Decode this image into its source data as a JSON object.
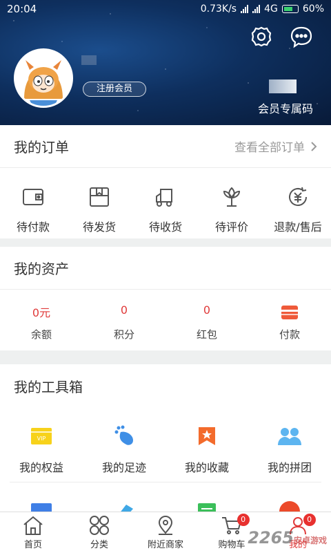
{
  "status_bar": {
    "time": "20:04",
    "speed": "0.73K/s",
    "network": "4G",
    "battery": "60%"
  },
  "header": {
    "register_label": "注册会员",
    "member_code_label": "会员专属码"
  },
  "orders": {
    "title": "我的订单",
    "view_all": "查看全部订单",
    "items": [
      {
        "label": "待付款",
        "icon": "wallet-icon"
      },
      {
        "label": "待发货",
        "icon": "package-icon"
      },
      {
        "label": "待收货",
        "icon": "truck-icon"
      },
      {
        "label": "待评价",
        "icon": "flower-icon"
      },
      {
        "label": "退款/售后",
        "icon": "refund-icon"
      }
    ]
  },
  "assets": {
    "title": "我的资产",
    "items": [
      {
        "value": "0元",
        "label": "余额"
      },
      {
        "value": "0",
        "label": "积分"
      },
      {
        "value": "0",
        "label": "红包"
      },
      {
        "value": "",
        "label": "付款",
        "icon": "card-icon"
      }
    ]
  },
  "toolbox": {
    "title": "我的工具箱",
    "row1": [
      {
        "label": "我的权益",
        "icon": "vip-icon"
      },
      {
        "label": "我的足迹",
        "icon": "footprint-icon"
      },
      {
        "label": "我的收藏",
        "icon": "favorite-icon"
      },
      {
        "label": "我的拼团",
        "icon": "group-icon"
      }
    ],
    "vip_text": "VIP"
  },
  "tabbar": {
    "items": [
      {
        "label": "首页",
        "icon": "home-icon"
      },
      {
        "label": "分类",
        "icon": "category-icon"
      },
      {
        "label": "附近商家",
        "icon": "location-icon"
      },
      {
        "label": "购物车",
        "icon": "cart-icon",
        "badge": "0"
      },
      {
        "label": "我的",
        "icon": "user-icon",
        "badge": "0"
      }
    ]
  },
  "watermark": {
    "text": "2265",
    "sub": "安卓游戏"
  },
  "colors": {
    "accent": "#e03a3a",
    "hero": "#0e2f5e"
  }
}
